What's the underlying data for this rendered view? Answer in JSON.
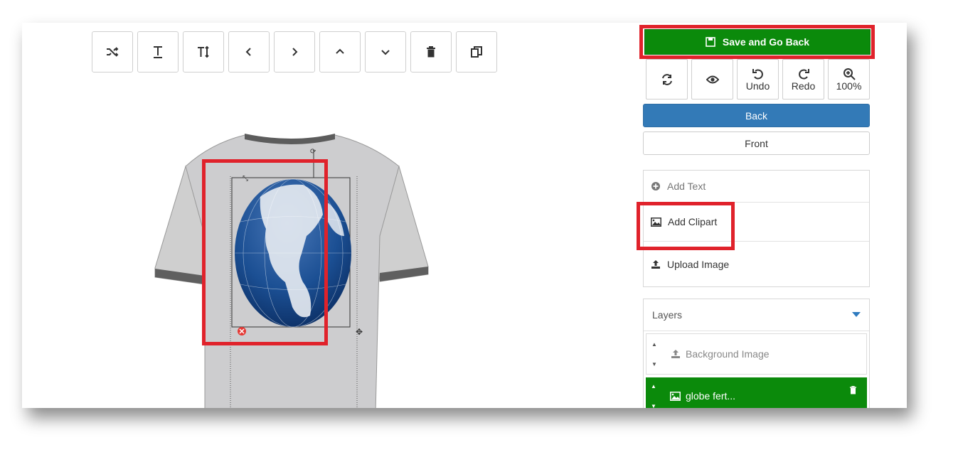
{
  "toolbar": {
    "items": [
      {
        "name": "shuffle-icon"
      },
      {
        "name": "text-style-icon"
      },
      {
        "name": "text-height-icon"
      },
      {
        "name": "chevron-left-icon"
      },
      {
        "name": "chevron-right-icon"
      },
      {
        "name": "chevron-up-icon"
      },
      {
        "name": "chevron-down-icon"
      },
      {
        "name": "trash-icon"
      },
      {
        "name": "copy-icon"
      }
    ]
  },
  "actions": {
    "save_label": "Save and Go Back",
    "undo_label": "Undo",
    "redo_label": "Redo",
    "zoom_label": "100%",
    "back_label": "Back",
    "front_label": "Front"
  },
  "add_panel": {
    "add_text": "Add Text",
    "add_clipart": "Add Clipart",
    "upload_image": "Upload Image"
  },
  "layers": {
    "header": "Layers",
    "items": [
      {
        "label": "Background Image"
      },
      {
        "label": "globe fert..."
      }
    ]
  },
  "colors": {
    "save_green": "#0b8a0b",
    "back_blue": "#337ab7",
    "highlight_red": "#e0222b",
    "layer_active": "#0b8a0b"
  }
}
